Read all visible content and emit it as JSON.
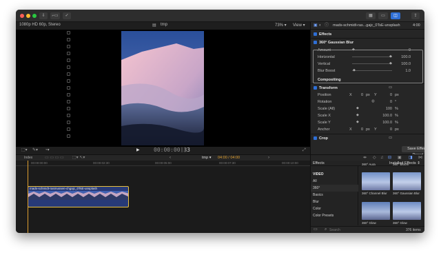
{
  "viewer": {
    "format_info": "1080p HD 60p, Stereo",
    "project_name": "tmp",
    "zoom": "73%",
    "view_menu": "View",
    "timecode": "00:00:00",
    "frame": "33"
  },
  "inspector": {
    "clip_name": "mads-schmidt-ras...gajc_0TsE-unsplash",
    "duration": "4:00",
    "effects_heading": "Effects",
    "blur_title": "360° Gaussian Blur",
    "amount": {
      "label": "Amount",
      "value": "0"
    },
    "horizontal": {
      "label": "Horizontal",
      "value": "100.0"
    },
    "vertical": {
      "label": "Vertical",
      "value": "100.0"
    },
    "blur_boost": {
      "label": "Blur Boost",
      "value": "1.0"
    },
    "compositing": "Compositing",
    "transform": "Transform",
    "position": {
      "label": "Position",
      "x_label": "X",
      "x_value": "0",
      "x_unit": "px",
      "y_label": "Y",
      "y_value": "0",
      "y_unit": "px"
    },
    "rotation": {
      "label": "Rotation",
      "value": "0",
      "unit": "°"
    },
    "scale_all": {
      "label": "Scale (All)",
      "value": "100",
      "unit": "%"
    },
    "scale_x": {
      "label": "Scale X",
      "value": "100.0",
      "unit": "%"
    },
    "scale_y": {
      "label": "Scale Y",
      "value": "100.0",
      "unit": "%"
    },
    "anchor": {
      "label": "Anchor",
      "x_label": "X",
      "x_value": "0",
      "x_unit": "px",
      "y_label": "Y",
      "y_value": "0",
      "y_unit": "px"
    },
    "crop": "Crop",
    "save_preset": "Save Effects Preset"
  },
  "timeline": {
    "index_label": "Index",
    "project_menu": "tmp",
    "position": "04:00 / 04:00",
    "ruler": [
      "00:00:00:00",
      "00:00:02:30",
      "00:00:05:00",
      "00:00:07:30",
      "00:00:10:00"
    ],
    "clip_name": "mads-schmidt-rasmussen-chgajc_0TsE-unsplash"
  },
  "browser": {
    "title": "Effects",
    "filter": "Installed Effects",
    "categories": [
      "VIDEO",
      "All",
      "360°",
      "Basics",
      "Blur",
      "Color",
      "Color Presets"
    ],
    "top_labels": [
      "360° Aura",
      "360° Bloom"
    ],
    "effects": [
      "360° Channel Blur",
      "360° Gaussian Blur",
      "360° Glow",
      "360° Glow"
    ],
    "search_placeholder": "Search",
    "count": "376 items"
  },
  "colors": {
    "accent": "#2f6fd6",
    "clip_border": "#e8c040",
    "playhead": "#e0a030",
    "background": "#1e1e1e"
  }
}
